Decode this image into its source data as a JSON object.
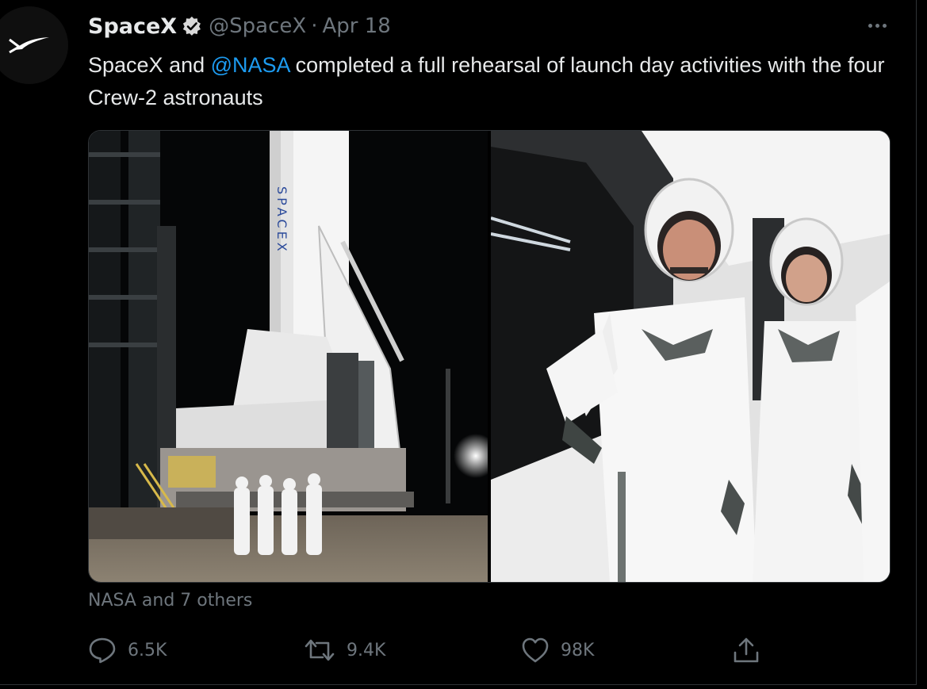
{
  "tweet": {
    "author_name": "SpaceX",
    "handle": "@SpaceX",
    "separator": "·",
    "date": "Apr 18",
    "text_before": "SpaceX and ",
    "mention": "@NASA",
    "text_after": " completed a full rehearsal of launch day activities with the four Crew-2 astronauts",
    "tagged": "NASA and 7 others",
    "media": [
      {
        "name": "rocket-launchpad-photo"
      },
      {
        "name": "astronauts-photo"
      }
    ]
  },
  "actions": {
    "reply_count": "6.5K",
    "retweet_count": "9.4K",
    "like_count": "98K"
  },
  "icons": {
    "reply": "reply-icon",
    "retweet": "retweet-icon",
    "like": "heart-icon",
    "share": "share-icon",
    "more": "more-icon",
    "verified": "verified-badge-icon"
  },
  "colors": {
    "background": "#000000",
    "text_primary": "#e7e9ea",
    "text_secondary": "#6e767d",
    "link": "#1d9bf0"
  }
}
